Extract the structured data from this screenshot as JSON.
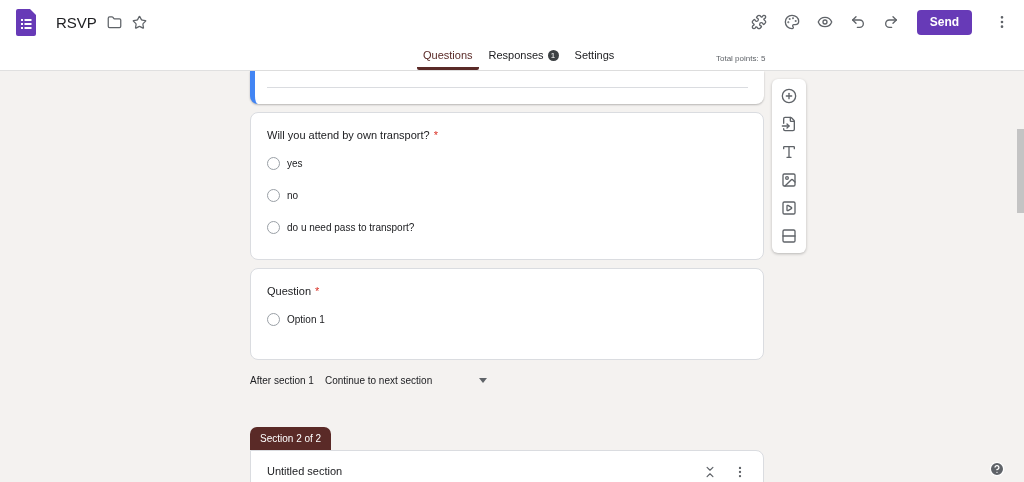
{
  "header": {
    "title": "RSVP",
    "send_label": "Send"
  },
  "tabs": [
    {
      "label": "Questions",
      "selected": true
    },
    {
      "label": "Responses",
      "selected": false,
      "badge": "1"
    },
    {
      "label": "Settings",
      "selected": false
    }
  ],
  "total_points": "Total points: 5",
  "questions": [
    {
      "title": "Will you attend by own transport?",
      "required": true,
      "required_mark": "*",
      "options": [
        {
          "label": "yes",
          "selected": false
        },
        {
          "label": "no",
          "selected": false
        },
        {
          "label": "do u need pass to transport?",
          "selected": false
        }
      ]
    },
    {
      "title": "Question",
      "required": true,
      "required_mark": "*",
      "options": [
        {
          "label": "Option 1",
          "selected": false
        }
      ]
    }
  ],
  "after_section": {
    "label": "After section 1",
    "value": "Continue to next section"
  },
  "section": {
    "tag": "Section 2 of 2",
    "title": "Untitled section"
  }
}
